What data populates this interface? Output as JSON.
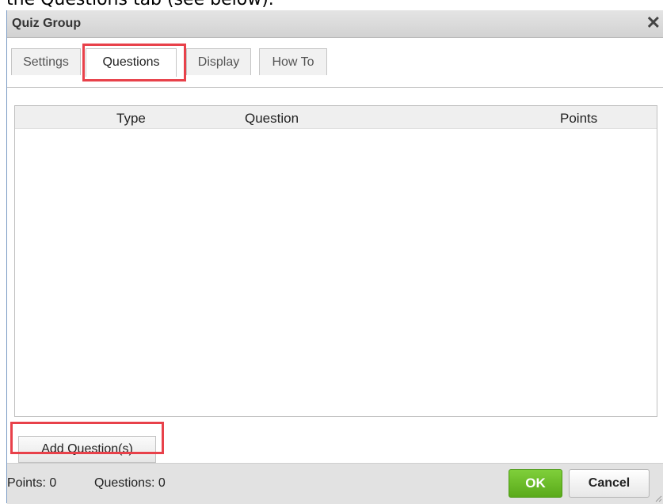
{
  "caption": "the Questions tab (see below).",
  "dialog": {
    "title": "Quiz Group",
    "close_icon": "close-icon",
    "tabs": [
      {
        "label": "Settings"
      },
      {
        "label": "Questions"
      },
      {
        "label": "Display"
      },
      {
        "label": "How To"
      }
    ],
    "active_tab": "Questions",
    "table": {
      "columns": [
        "Type",
        "Question",
        "Points"
      ],
      "rows": []
    },
    "add_button": "Add Question(s)",
    "footer": {
      "points_text": "Points: 0",
      "questions_text": "Questions: 0",
      "ok_label": "OK",
      "cancel_label": "Cancel"
    },
    "colors": {
      "highlight": "#e8414a",
      "ok": "#6cbc27"
    }
  }
}
